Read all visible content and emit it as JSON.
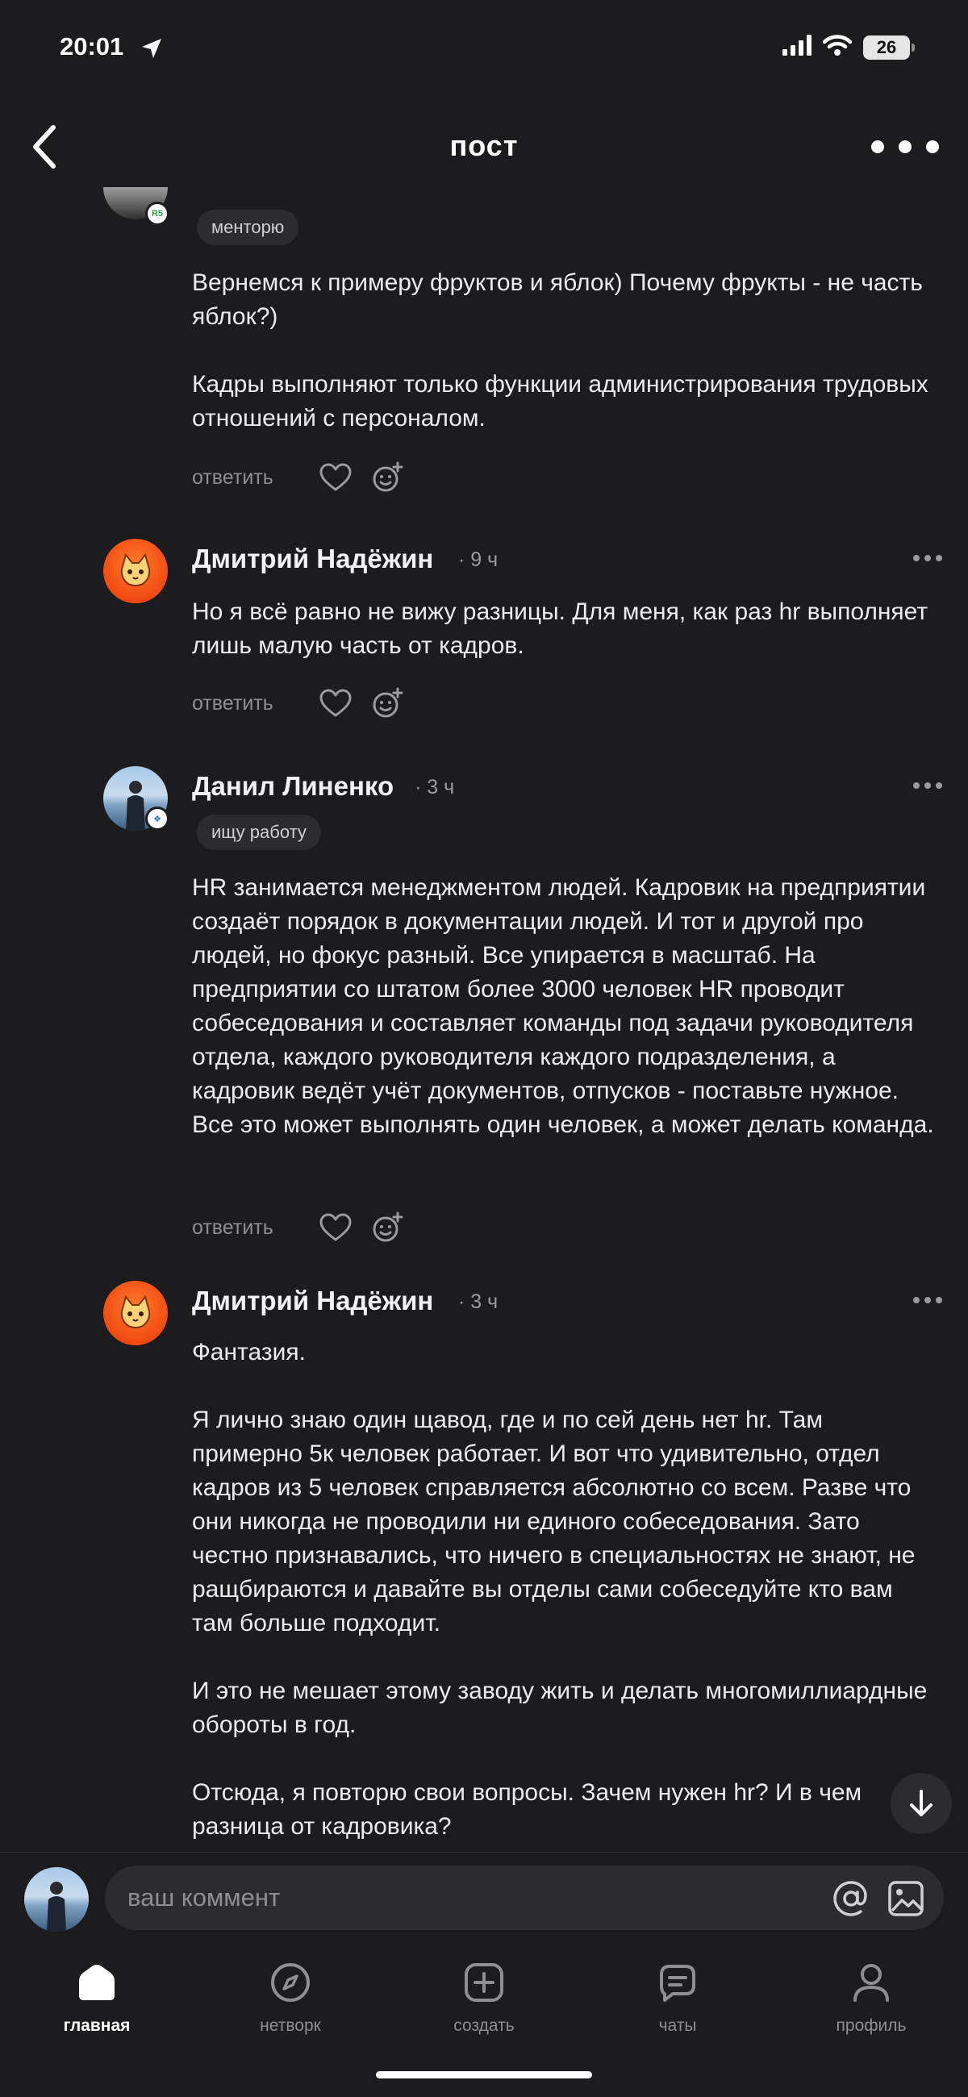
{
  "status_bar": {
    "time": "20:01",
    "battery": "26"
  },
  "header": {
    "title": "пост"
  },
  "comments": [
    {
      "tag": "менторю",
      "paragraphs": [
        "Вернемся к примеру фруктов и яблок) Почему фрукты - не часть яблок?)",
        "Кадры выполняют только функции администрирования трудовых отношений с персоналом."
      ],
      "reply_label": "ответить"
    },
    {
      "author": "Дмитрий Надёжин",
      "time": "· 9 ч",
      "paragraphs": [
        "Но я всё равно не вижу разницы. Для меня, как раз hr выполняет лишь малую часть от кадров."
      ],
      "reply_label": "ответить"
    },
    {
      "author": "Данил Линенко",
      "time": "· 3 ч",
      "tag": "ищу работу",
      "paragraphs": [
        "HR занимается менеджментом людей. Кадровик на предприятии создаёт порядок в документации людей. И тот и другой про людей, но фокус разный. Все упирается в масштаб. На предприятии со штатом более 3000 человек HR проводит собеседования и составляет команды под задачи руководителя отдела, каждого руководителя каждого подразделения, а кадровик ведёт учёт документов, отпусков - поставьте нужное. Все это может выполнять один человек, а может делать команда."
      ],
      "reply_label": "ответить"
    },
    {
      "author": "Дмитрий Надёжин",
      "time": "· 3 ч",
      "paragraphs": [
        "Фантазия.",
        "Я лично знаю один щавод, где и по сей день нет hr. Там примерно 5к человек работает. И вот что удивительно, отдел кадров из 5 человек справляется абсолютно со всем. Разве что они никогда не проводили ни единого собеседования. Зато честно признавались, что ничего в специальностях не знают, не ращбираются и давайте вы отделы сами собеседуйте кто вам там больше подходит.",
        "И это не мешает этому заводу жить и делать многомиллиардные обороты в год.",
        "Отсюда, я повторю свои вопросы. Зачем нужен hr? И в чем разница от кадровика?"
      ]
    }
  ],
  "comment_input": {
    "placeholder": "ваш коммент"
  },
  "nav": {
    "items": [
      {
        "label": "главная",
        "icon": "home-icon"
      },
      {
        "label": "нетворк",
        "icon": "compass-icon"
      },
      {
        "label": "создать",
        "icon": "plus-square-icon"
      },
      {
        "label": "чаты",
        "icon": "chat-icon"
      },
      {
        "label": "профиль",
        "icon": "user-icon"
      }
    ],
    "active": "главная"
  },
  "colors": {
    "background": "#1c1c1e",
    "avatar_orange": "#f14a12",
    "muted": "#8e8e93"
  }
}
